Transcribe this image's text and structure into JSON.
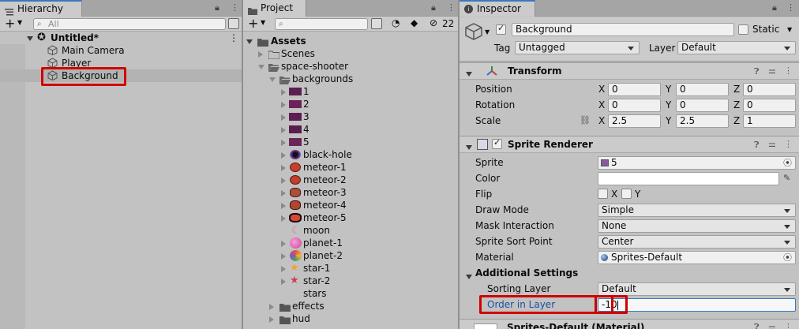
{
  "hierarchy": {
    "tab": "Hierarchy",
    "add": "+",
    "search_placeholder": "All",
    "scene": "Untitled*",
    "items": [
      "Main Camera",
      "Player",
      "Background"
    ]
  },
  "project": {
    "tab": "Project",
    "add": "+",
    "hidden_count": "22",
    "root": "Assets",
    "folders": {
      "scenes": "Scenes",
      "space_shooter": "space-shooter",
      "backgrounds": "backgrounds",
      "effects": "effects",
      "hud": "hud"
    },
    "bg_items": [
      "1",
      "2",
      "3",
      "4",
      "5"
    ],
    "sprites": [
      "black-hole",
      "meteor-1",
      "meteor-2",
      "meteor-3",
      "meteor-4",
      "meteor-5",
      "moon",
      "planet-1",
      "planet-2",
      "star-1",
      "star-2",
      "stars"
    ]
  },
  "inspector": {
    "tab": "Inspector",
    "name": "Background",
    "static_label": "Static",
    "tag_label": "Tag",
    "tag_value": "Untagged",
    "layer_label": "Layer",
    "layer_value": "Default",
    "transform": {
      "title": "Transform",
      "rows": [
        {
          "label": "Position",
          "x": "0",
          "y": "0",
          "z": "0"
        },
        {
          "label": "Rotation",
          "x": "0",
          "y": "0",
          "z": "0"
        },
        {
          "label": "Scale",
          "x": "2.5",
          "y": "2.5",
          "z": "1"
        }
      ],
      "axes": [
        "X",
        "Y",
        "Z"
      ]
    },
    "sprite_renderer": {
      "title": "Sprite Renderer",
      "sprite_label": "Sprite",
      "sprite_value": "5",
      "color_label": "Color",
      "flip_label": "Flip",
      "flip_x": "X",
      "flip_y": "Y",
      "draw_mode_label": "Draw Mode",
      "draw_mode_value": "Simple",
      "mask_label": "Mask Interaction",
      "mask_value": "None",
      "sort_point_label": "Sprite Sort Point",
      "sort_point_value": "Center",
      "material_label": "Material",
      "material_value": "Sprites-Default",
      "additional": "Additional Settings",
      "sorting_layer_label": "Sorting Layer",
      "sorting_layer_value": "Default",
      "order_label": "Order in Layer",
      "order_value": "-10"
    },
    "material_footer": "Sprites-Default (Material)"
  },
  "colors": {
    "highlight": "#d10000",
    "selected_row": "#b3b3b3",
    "accent": "#3a79bb"
  }
}
